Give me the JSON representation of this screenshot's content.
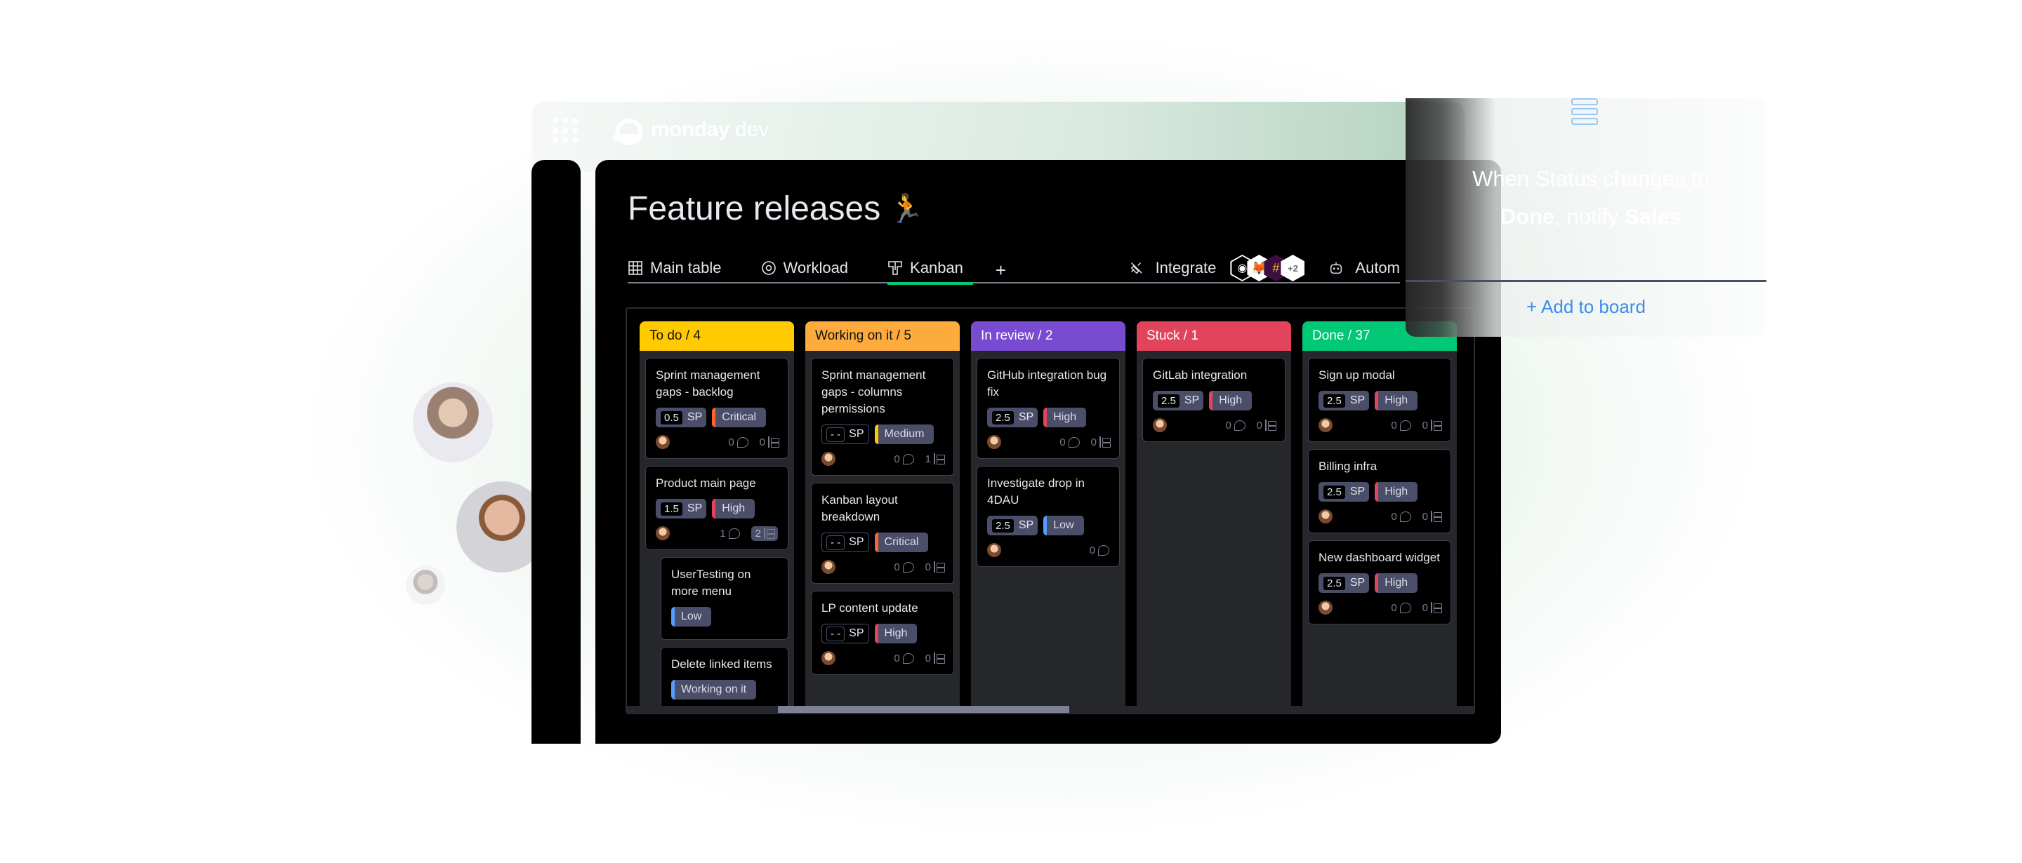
{
  "app": {
    "brand": "monday",
    "brand_sub": "dev"
  },
  "board": {
    "title": "Feature releases",
    "title_emoji": "🏃"
  },
  "tabs": [
    {
      "label": "Main table",
      "icon": "grid-table-icon",
      "active": false
    },
    {
      "label": "Workload",
      "icon": "workload-circle-icon",
      "active": false
    },
    {
      "label": "Kanban",
      "icon": "kanban-icon",
      "active": true
    }
  ],
  "tab_add": "+",
  "toolbar": {
    "integrate_label": "Integrate",
    "integrations": [
      "github",
      "gitlab",
      "slack"
    ],
    "integrations_more": "+2",
    "automate_label": "Autom"
  },
  "columns": [
    {
      "title": "To do / 4",
      "color": "#ffcb00",
      "text": "dark",
      "cards": [
        {
          "title": "Sprint management gaps - backlog",
          "sp": "0.5",
          "sp_unit": "SP",
          "priority": "Critical",
          "priority_color": "#ff642e",
          "comments": "0",
          "subitems": "0"
        },
        {
          "title": "Product main page",
          "sp": "1.5",
          "sp_unit": "SP",
          "priority": "High",
          "priority_color": "#e2445c",
          "comments": "1",
          "subitems": "2",
          "subitems_highlight": true
        },
        {
          "title": "UserTesting on more menu",
          "priority": "Low",
          "priority_color": "#579bfc",
          "sub": true
        },
        {
          "title": "Delete linked items",
          "priority": "Working on it",
          "priority_color": "#579bfc",
          "sub": true
        }
      ]
    },
    {
      "title": "Working on it / 5",
      "color": "#fdab3d",
      "text": "dark",
      "cards": [
        {
          "title": "Sprint management gaps - columns permissions",
          "sp": "- -",
          "sp_unit": "SP",
          "sp_empty": true,
          "priority": "Medium",
          "priority_color": "#ffcb00",
          "comments": "0",
          "subitems": "1"
        },
        {
          "title": "Kanban layout breakdown",
          "sp": "- -",
          "sp_unit": "SP",
          "sp_empty": true,
          "priority": "Critical",
          "priority_color": "#ff642e",
          "comments": "0",
          "subitems": "0"
        },
        {
          "title": "LP content update",
          "sp": "- -",
          "sp_unit": "SP",
          "sp_empty": true,
          "priority": "High",
          "priority_color": "#e2445c",
          "comments": "0",
          "subitems": "0"
        }
      ]
    },
    {
      "title": "In review / 2",
      "color": "#784bd1",
      "text": "light",
      "cards": [
        {
          "title": "GitHub integration bug fix",
          "sp": "2.5",
          "sp_unit": "SP",
          "priority": "High",
          "priority_color": "#e2445c",
          "comments": "0",
          "subitems": "0"
        },
        {
          "title": "Investigate drop in 4DAU",
          "sp": "2.5",
          "sp_unit": "SP",
          "priority": "Low",
          "priority_color": "#579bfc",
          "comments": "0"
        }
      ]
    },
    {
      "title": "Stuck / 1",
      "color": "#e2445c",
      "text": "light",
      "cards": [
        {
          "title": "GitLab integration",
          "sp": "2.5",
          "sp_unit": "SP",
          "priority": "High",
          "priority_color": "#e2445c",
          "comments": "0",
          "subitems": "0"
        }
      ]
    },
    {
      "title": "Done  / 37",
      "color": "#00c875",
      "text": "light",
      "cards": [
        {
          "title": "Sign up modal",
          "sp": "2.5",
          "sp_unit": "SP",
          "priority": "High",
          "priority_color": "#e2445c",
          "comments": "0",
          "subitems": "0"
        },
        {
          "title": "Billing infra",
          "sp": "2.5",
          "sp_unit": "SP",
          "priority": "High",
          "priority_color": "#e2445c",
          "comments": "0",
          "subitems": "0"
        },
        {
          "title": "New dashboard widget",
          "sp": "2.5",
          "sp_unit": "SP",
          "priority": "High",
          "priority_color": "#e2445c",
          "comments": "0",
          "subitems": "0"
        }
      ]
    }
  ],
  "automation": {
    "text_when": "When ",
    "text_status": "Status",
    "text_changes": " changes to",
    "text_done": "Done",
    "text_notify": ", notify ",
    "text_sales": "Sales",
    "add_label": "+ Add to board"
  }
}
